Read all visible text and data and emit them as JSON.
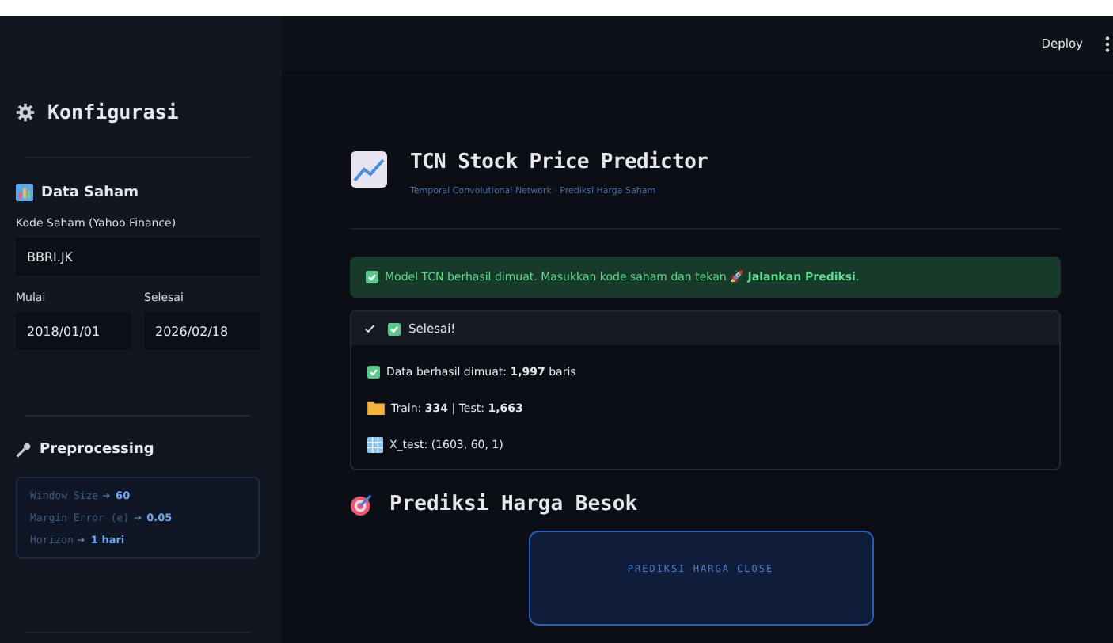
{
  "header": {
    "deploy": "Deploy"
  },
  "sidebar": {
    "title": "Konfigurasi",
    "data_section": {
      "title": "Data Saham",
      "ticker_label": "Kode Saham (Yahoo Finance)",
      "ticker_value": "BBRI.JK",
      "start_label": "Mulai",
      "start_value": "2018/01/01",
      "end_label": "Selesai",
      "end_value": "2026/02/18"
    },
    "preprocessing": {
      "title": "Preprocessing",
      "params": [
        {
          "name": "Window Size",
          "value": "60"
        },
        {
          "name": "Margin Error (e)",
          "value": "0.05"
        },
        {
          "name": "Horizon",
          "value": "1 hari"
        }
      ]
    }
  },
  "main": {
    "title": "TCN Stock Price Predictor",
    "subtitle": "Temporal Convolutional Network · Prediksi Harga Saham",
    "alert": "Model TCN berhasil dimuat. Masukkan kode saham dan tekan 🚀 **Jalankan Prediksi**.",
    "status": {
      "label": "Selesai!",
      "expanded": true,
      "lines": [
        {
          "kind": "check",
          "text": "Data berhasil dimuat: **1,997** baris"
        },
        {
          "kind": "folder",
          "text": "Train: **334** | Test: **1,663**"
        },
        {
          "kind": "grid",
          "text": "X_test: (1603, 60, 1)"
        }
      ]
    },
    "prediction": {
      "title": "Prediksi Harga Besok",
      "card_label": "PREDIKSI HARGA CLOSE"
    }
  }
}
